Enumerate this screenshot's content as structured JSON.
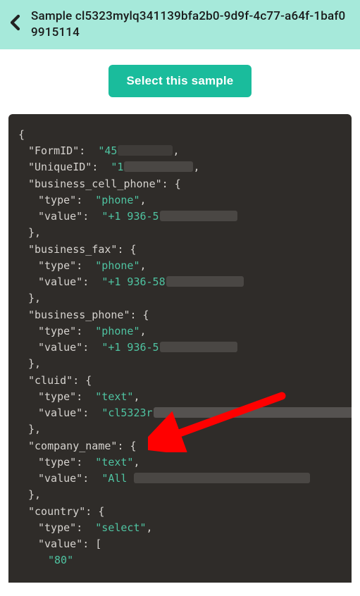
{
  "header": {
    "title": "Sample cl5323mylq341139bfa2b0-9d9f-4c77-a64f-1baf09915114"
  },
  "action": {
    "select_label": "Select this sample"
  },
  "code": {
    "form_id_key": "\"FormID\"",
    "form_id_val": "\"45",
    "unique_id_key": "\"UniqueID\"",
    "unique_id_val": "\"1",
    "bcp_key": "\"business_cell_phone\"",
    "type_key": "\"type\"",
    "value_key": "\"value\"",
    "phone_val": "\"phone\"",
    "text_val": "\"text\"",
    "select_val": "\"select\"",
    "phone_num_a": "\"+1 936-5",
    "phone_num_b": "\"+1 936-58",
    "phone_num_c": "\"+1 936-5",
    "bfax_key": "\"business_fax\"",
    "bphone_key": "\"business_phone\"",
    "cluid_key": "\"cluid\"",
    "cluid_val": "\"cl5323r",
    "company_key": "\"company_name\"",
    "company_val": "\"All ",
    "country_key": "\"country\"",
    "value_arr_key": "\"value\"",
    "arr_item": "\"80\""
  }
}
